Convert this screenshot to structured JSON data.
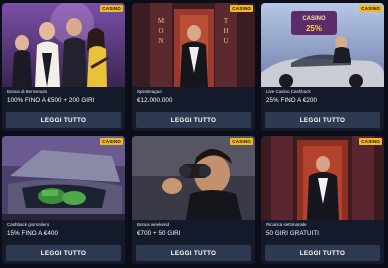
{
  "cards": [
    {
      "badge": "CASINO",
      "title": "Bonus di Benvenuto",
      "value": "100% FINO A €500 + 200 GIRI",
      "button": "LEGGI TUTTO"
    },
    {
      "badge": "CASINO",
      "title": "Spinsleague",
      "value": "€12.000.000",
      "button": "LEGGI TUTTO"
    },
    {
      "badge": "CASINO",
      "title": "Live Casino Cashback",
      "value": "25% FINO A €200",
      "button": "LEGGI TUTTO"
    },
    {
      "badge": "CASINO",
      "title": "Cashback giornaliero",
      "value": "15% FINO A €400",
      "button": "LEGGI TUTTO"
    },
    {
      "badge": "CASINO",
      "title": "Bonus weekend",
      "value": "€700 + 50 GIRI",
      "button": "LEGGI TUTTO"
    },
    {
      "badge": "CASINO",
      "title": "Ricarica settimanale",
      "value": "50 GIRI GRATUITI",
      "button": "LEGGI TUTTO"
    }
  ],
  "art": {
    "door_sign_left": "MON",
    "door_sign_right": "THU",
    "casino_sign_line1": "CASINO",
    "casino_sign_line2": "25%",
    "icons": [
      "gangster-group-art",
      "door-man-art",
      "casino-car-art",
      "car-trunk-art",
      "binoculars-man-art",
      "doorway-man-art"
    ]
  },
  "colors": {
    "badge": "#f2b91c",
    "button": "#2e3a52",
    "card": "#141a2a"
  }
}
